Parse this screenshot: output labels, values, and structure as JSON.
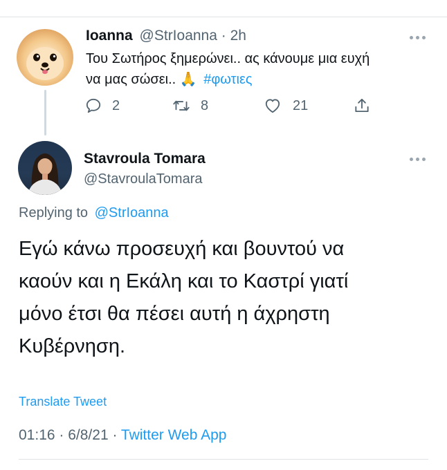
{
  "original_tweet": {
    "display_name": "Ioanna",
    "handle": "@StrIoanna",
    "separator": "·",
    "time_ago": "2h",
    "text_line1": "Του Σωτήρος ξημερώνει.. ας κάνουμε μια ευχή",
    "text_line2": "να μας σώσει.. ",
    "emoji": "🙏",
    "hashtag": "#φωτιες",
    "replies": "2",
    "retweets": "8",
    "likes": "21"
  },
  "reply_tweet": {
    "display_name": "Stavroula Tomara",
    "handle": "@StavroulaTomara",
    "replying_label": "Replying to",
    "replying_handle": "@StrIoanna",
    "text_lines": [
      "Εγώ κάνω προσευχή και βουντού να",
      "καούν και η Εκάλη και το Καστρί γιατί",
      "μόνο έτσι θα πέσει αυτή η άχρηστη",
      "Κυβέρνηση."
    ],
    "translate_label": "Translate Tweet",
    "time": "01:16",
    "date": "6/8/21",
    "source": "Twitter Web App"
  },
  "colors": {
    "accent": "#1d9bf0",
    "muted": "#536471",
    "text": "#0f1419",
    "divider": "#dfe3e6"
  },
  "icons": [
    "more-icon",
    "reply-icon",
    "retweet-icon",
    "like-icon",
    "share-icon"
  ]
}
